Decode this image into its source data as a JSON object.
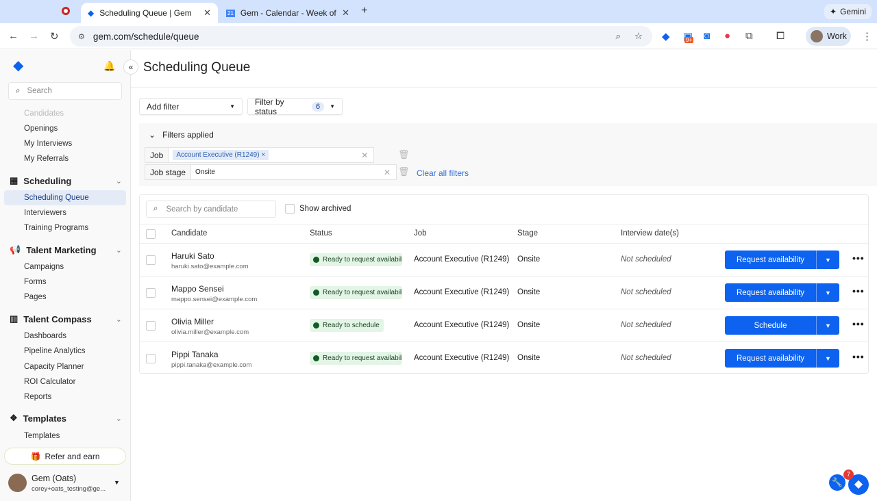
{
  "browser": {
    "tabs": [
      {
        "label": "Scheduling Queue | Gem",
        "active": true
      },
      {
        "label": "Gem - Calendar - Week of No"
      }
    ],
    "gemini_label": "Gemini",
    "url": "gem.com/schedule/queue",
    "profile_label": "Work",
    "ext_badge": "9+"
  },
  "sidebar": {
    "search_placeholder": "Search",
    "items_top": [
      "Candidates",
      "Openings",
      "My Interviews",
      "My Referrals"
    ],
    "sections": [
      {
        "title": "Scheduling",
        "items": [
          "Scheduling Queue",
          "Interviewers",
          "Training Programs"
        ]
      },
      {
        "title": "Talent Marketing",
        "items": [
          "Campaigns",
          "Forms",
          "Pages"
        ]
      },
      {
        "title": "Talent Compass",
        "items": [
          "Dashboards",
          "Pipeline Analytics",
          "Capacity Planner",
          "ROI Calculator",
          "Reports"
        ]
      },
      {
        "title": "Templates",
        "items": [
          "Templates"
        ]
      }
    ],
    "refer_label": "Refer and earn",
    "user": {
      "name": "Gem (Oats)",
      "email": "corey+oats_testing@ge..."
    }
  },
  "main": {
    "title": "Scheduling Queue",
    "add_filter": "Add filter",
    "filter_status": "Filter by status",
    "filter_status_count": "6",
    "filters_applied": "Filters applied",
    "filters": [
      {
        "label": "Job",
        "value": "Account Executive (R1249)",
        "chip": true
      },
      {
        "label": "Job stage",
        "value": "Onsite",
        "chip": false
      }
    ],
    "clear_all": "Clear all filters",
    "search_placeholder": "Search by candidate",
    "show_archived": "Show archived",
    "columns": [
      "Candidate",
      "Status",
      "Job",
      "Stage",
      "Interview date(s)"
    ],
    "rows": [
      {
        "name": "Haruki Sato",
        "email": "haruki.sato@example.com",
        "status": "Ready to request availability",
        "job": "Account Executive (R1249)",
        "stage": "Onsite",
        "date": "Not scheduled",
        "action": "Request availability"
      },
      {
        "name": "Mappo Sensei",
        "email": "mappo.sensei@example.com",
        "status": "Ready to request availability",
        "job": "Account Executive (R1249)",
        "stage": "Onsite",
        "date": "Not scheduled",
        "action": "Request availability"
      },
      {
        "name": "Olivia Miller",
        "email": "olivia.miller@example.com",
        "status": "Ready to schedule",
        "job": "Account Executive (R1249)",
        "stage": "Onsite",
        "date": "Not scheduled",
        "action": "Schedule"
      },
      {
        "name": "Pippi Tanaka",
        "email": "pippi.tanaka@example.com",
        "status": "Ready to request availability",
        "job": "Account Executive (R1249)",
        "stage": "Onsite",
        "date": "Not scheduled",
        "action": "Request availability"
      }
    ]
  },
  "help_badge": "7",
  "colors": {
    "accent": "#0d62f0",
    "status_bg": "#e3f5e6",
    "link": "#2f6fd6"
  }
}
